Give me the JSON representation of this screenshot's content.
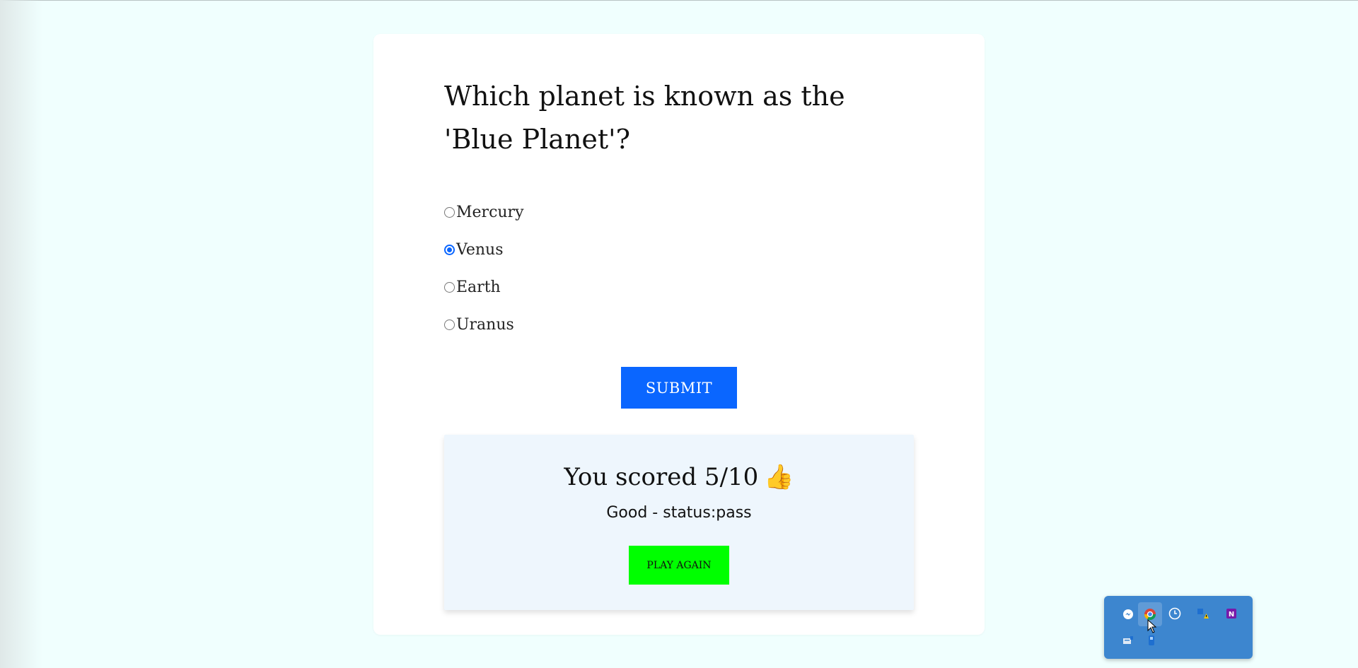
{
  "quiz": {
    "question": "Which planet is known as the 'Blue Planet'?",
    "options": [
      {
        "label": "Mercury",
        "selected": false
      },
      {
        "label": "Venus",
        "selected": true
      },
      {
        "label": "Earth",
        "selected": false
      },
      {
        "label": "Uranus",
        "selected": false
      }
    ],
    "submit_label": "SUBMIT"
  },
  "result": {
    "score_text": "You scored 5/10",
    "score_emoji": "👍",
    "status_text": "Good - status:pass",
    "play_again_label": "PLAY AGAIN"
  },
  "tray": {
    "icons": [
      "messenger-icon",
      "chrome-icon",
      "clock-icon",
      "defender-warning-icon",
      "onenote-icon",
      "network-adapter-icon",
      "bluetooth-device-icon"
    ]
  },
  "colors": {
    "page_background": "#f0fffe",
    "submit_button": "#0a66ff",
    "play_again_button": "#00ff00",
    "result_panel": "#eef6fd",
    "tray_background": "#3d86cf"
  }
}
